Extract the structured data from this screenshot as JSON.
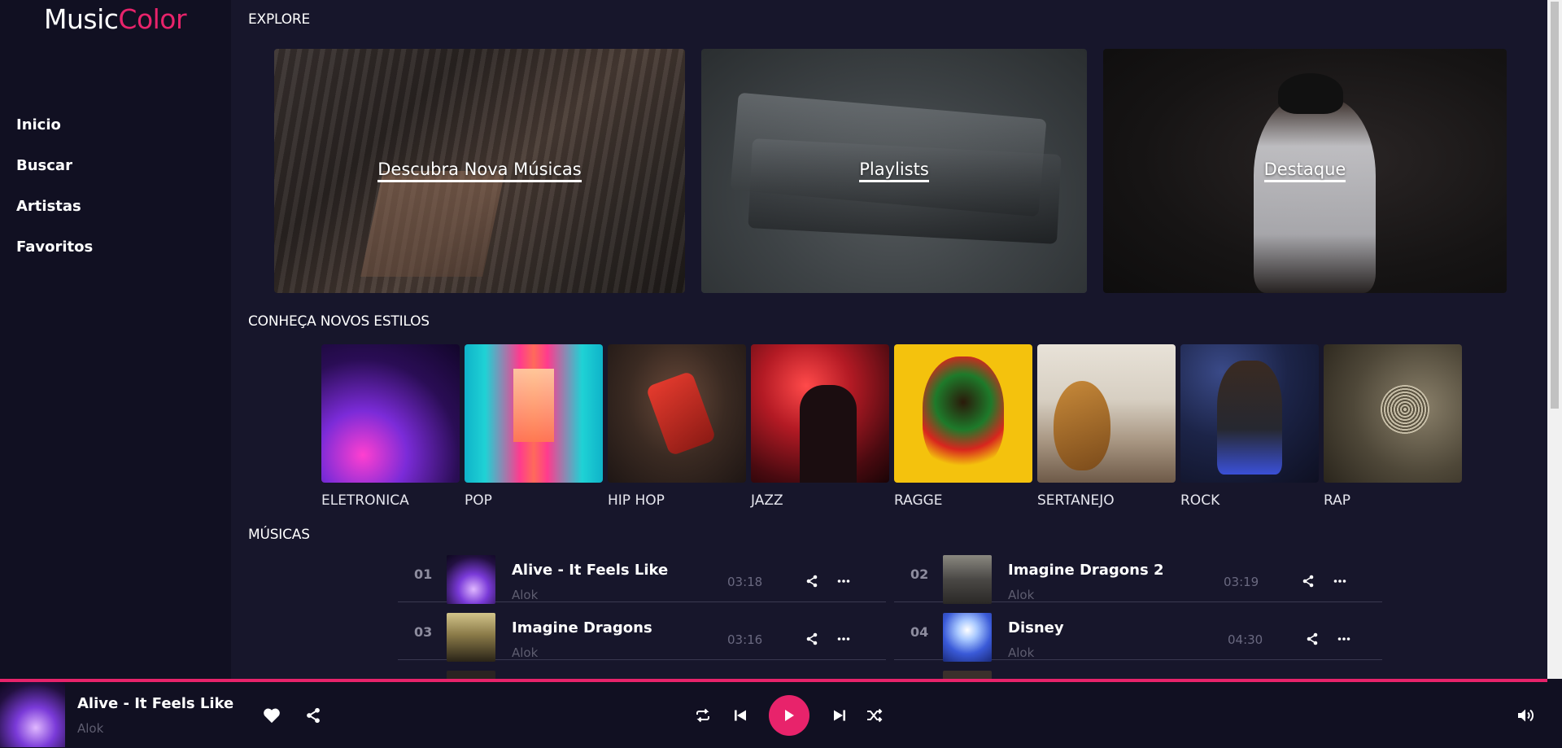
{
  "app": {
    "logo_part1": "Music",
    "logo_part2": "Color",
    "accent_color": "#e8236b",
    "background_color": "#15142a"
  },
  "sidebar": {
    "items": [
      {
        "label": "Inicio"
      },
      {
        "label": "Buscar"
      },
      {
        "label": "Artistas"
      },
      {
        "label": "Favoritos"
      }
    ]
  },
  "explore": {
    "title": "EXPLORE",
    "cards": [
      {
        "label": "Descubra Nova Músicas"
      },
      {
        "label": "Playlists"
      },
      {
        "label": "Destaque"
      }
    ]
  },
  "styles": {
    "title": "CONHEÇA NOVOS ESTILOS",
    "items": [
      {
        "label": "ELETRONICA"
      },
      {
        "label": "POP"
      },
      {
        "label": "HIP HOP"
      },
      {
        "label": "JAZZ"
      },
      {
        "label": "RAGGE"
      },
      {
        "label": "SERTANEJO"
      },
      {
        "label": "ROCK"
      },
      {
        "label": "RAP"
      }
    ]
  },
  "songs": {
    "title": "MÚSICAS",
    "tracks": [
      {
        "num": "01",
        "title": "Alive - It Feels Like",
        "artist": "Alok",
        "duration": "03:18"
      },
      {
        "num": "02",
        "title": "Imagine Dragons 2",
        "artist": "Alok",
        "duration": "03:19"
      },
      {
        "num": "03",
        "title": "Imagine Dragons",
        "artist": "Alok",
        "duration": "03:16"
      },
      {
        "num": "04",
        "title": "Disney",
        "artist": "Alok",
        "duration": "04:30"
      }
    ]
  },
  "player": {
    "title": "Alive - It Feels Like",
    "artist": "Alok",
    "icons": [
      "heart-icon",
      "share-icon",
      "repeat-icon",
      "previous-icon",
      "play-icon",
      "next-icon",
      "shuffle-icon",
      "volume-icon"
    ]
  }
}
